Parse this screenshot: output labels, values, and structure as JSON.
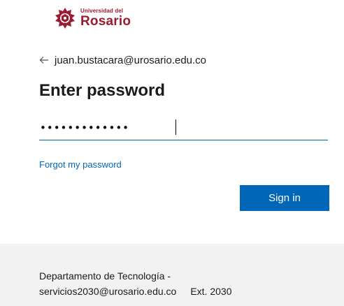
{
  "logo": {
    "small_text": "Universidad del",
    "big_text": "Rosario",
    "color": "#9b1b30"
  },
  "identity": {
    "email": "juan.bustacara@urosario.edu.co",
    "icon": "arrow-left-icon"
  },
  "title": "Enter password",
  "password": {
    "value": "•••••••••••••"
  },
  "forgot_link": "Forgot my password",
  "signin_button": "Sign in",
  "footer": {
    "line1": "Departamento de Tecnología -",
    "email": "servicios2030@urosario.edu.co",
    "ext": "Ext. 2030"
  },
  "colors": {
    "accent": "#0067b8",
    "footer_bg": "#f2f2f2"
  }
}
